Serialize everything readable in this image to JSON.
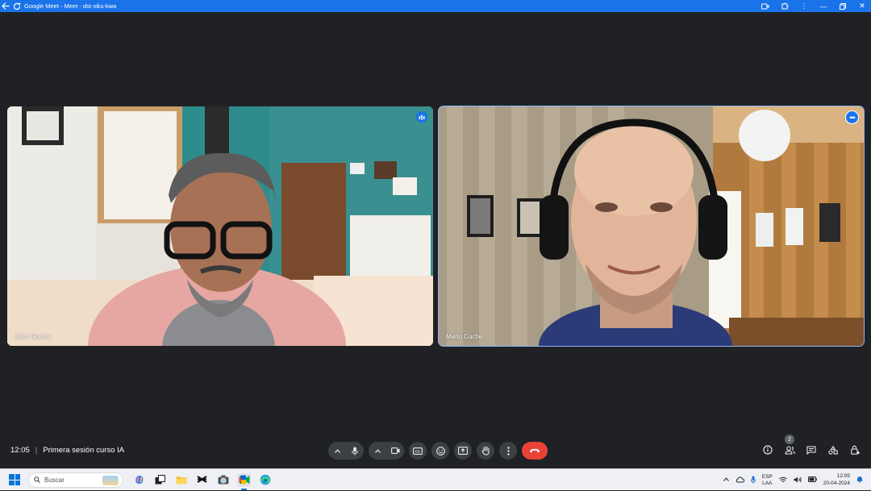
{
  "window": {
    "title": "Google Meet - Meet - dst-xiks-kwa",
    "icons": [
      "back-arrow-icon",
      "reload-icon",
      "camera-icon",
      "extensions-icon",
      "more-vert-icon",
      "minimize-icon",
      "restore-icon",
      "close-icon"
    ]
  },
  "participants": [
    {
      "name": "Juan Guerra",
      "speaking": true
    },
    {
      "name": "Mario Cuche",
      "pinned_focus": true
    }
  ],
  "meeting": {
    "time": "12:05",
    "separator": "|",
    "title": "Primera sesión curso IA"
  },
  "controls": {
    "center": [
      "mic-options",
      "microphone",
      "camera-options",
      "camera",
      "captions",
      "reactions",
      "present-screen",
      "raise-hand",
      "more-options",
      "leave-call"
    ],
    "right": [
      "meeting-details",
      "people",
      "chat",
      "activities",
      "host-controls"
    ],
    "people_count": "2",
    "captions_label": "CC"
  },
  "taskbar": {
    "search_placeholder": "Buscar",
    "apps": [
      "copilot",
      "task-view",
      "file-explorer",
      "capcut",
      "camera",
      "google-meet",
      "edge"
    ],
    "language_top": "ESP",
    "language_bottom": "LAA",
    "time": "12:05",
    "date": "20-04-2024"
  },
  "colors": {
    "accent": "#1a73e8",
    "stage_bg": "#202124",
    "button_bg": "#3c4043",
    "hangup": "#ea4335"
  }
}
